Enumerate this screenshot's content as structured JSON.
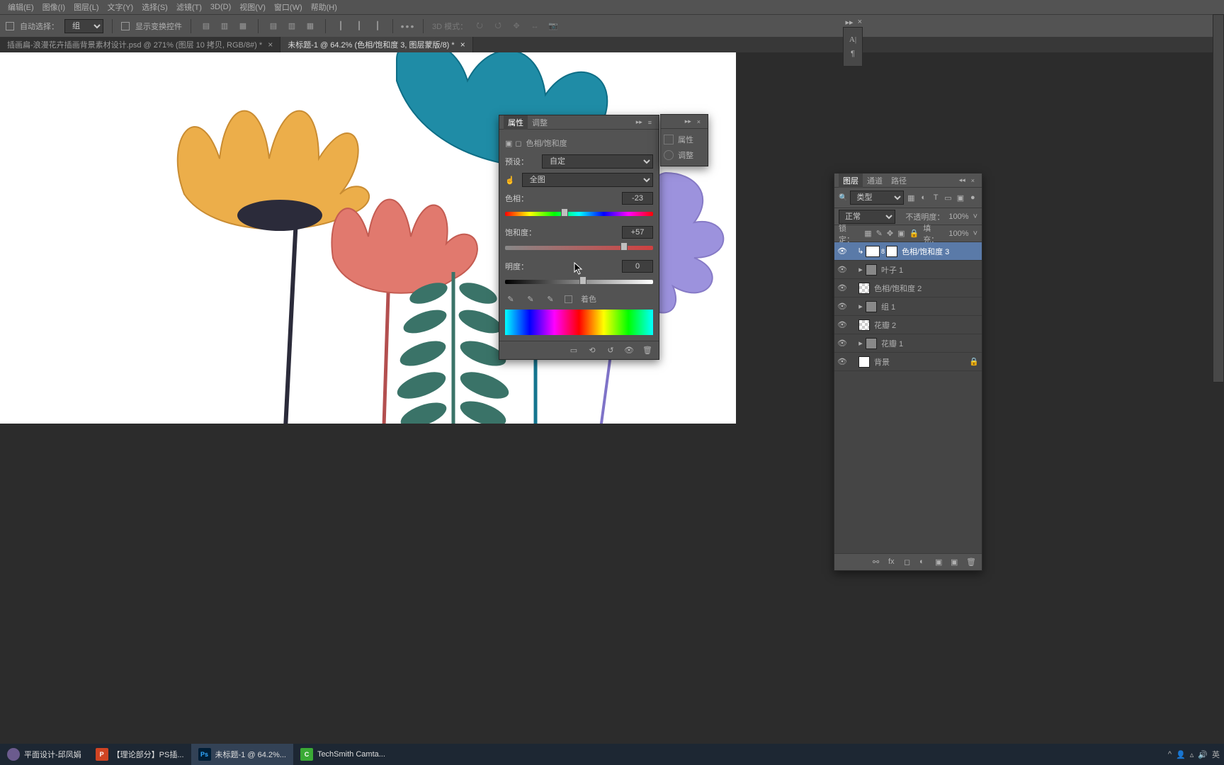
{
  "menu": {
    "items": [
      "编辑(E)",
      "图像(I)",
      "图层(L)",
      "文字(Y)",
      "选择(S)",
      "滤镜(T)",
      "3D(D)",
      "视图(V)",
      "窗口(W)",
      "帮助(H)"
    ]
  },
  "options": {
    "auto_select": "自动选择：",
    "auto_select_value": "组",
    "show_transform": "显示变换控件",
    "mode_3d": "3D 模式："
  },
  "tabs": {
    "t0": "插画扁-浪漫花卉插画背景素材设计.psd @ 271% (图层 10 拷贝, RGB/8#) *",
    "t1": "未标题-1 @ 64.2% (色相/饱和度 3, 图层蒙版/8) *"
  },
  "properties_panel": {
    "tab_properties": "属性",
    "tab_adjust": "调整",
    "adj_name": "色相/饱和度",
    "preset_label": "预设：",
    "preset_value": "自定",
    "range_value": "全图",
    "hue_label": "色相：",
    "hue_value": "-23",
    "sat_label": "饱和度：",
    "sat_value": "+57",
    "light_label": "明度：",
    "light_value": "0",
    "colorize": "着色"
  },
  "mini_panel": {
    "prop": "属性",
    "adj": "调整"
  },
  "layers_panel": {
    "tab_layers": "图层",
    "tab_channels": "通道",
    "tab_paths": "路径",
    "kind": "类型",
    "blend": "正常",
    "opacity_label": "不透明度：",
    "opacity_value": "100%",
    "lock_label": "锁定：",
    "fill_label": "填充：",
    "fill_value": "100%",
    "layers": {
      "l0": "色相/饱和度 3",
      "l1": "叶子 1",
      "l2": "色相/饱和度 2",
      "l3": "组 1",
      "l4": "花瓣 2",
      "l5": "花瓣 1",
      "l6": "背景"
    }
  },
  "taskbar": {
    "b0": "平面设计-邱凤娟",
    "b1": "【理论部分】PS插...",
    "b2": "未标题-1 @ 64.2%...",
    "b3": "TechSmith Camta...",
    "lang": "英"
  }
}
